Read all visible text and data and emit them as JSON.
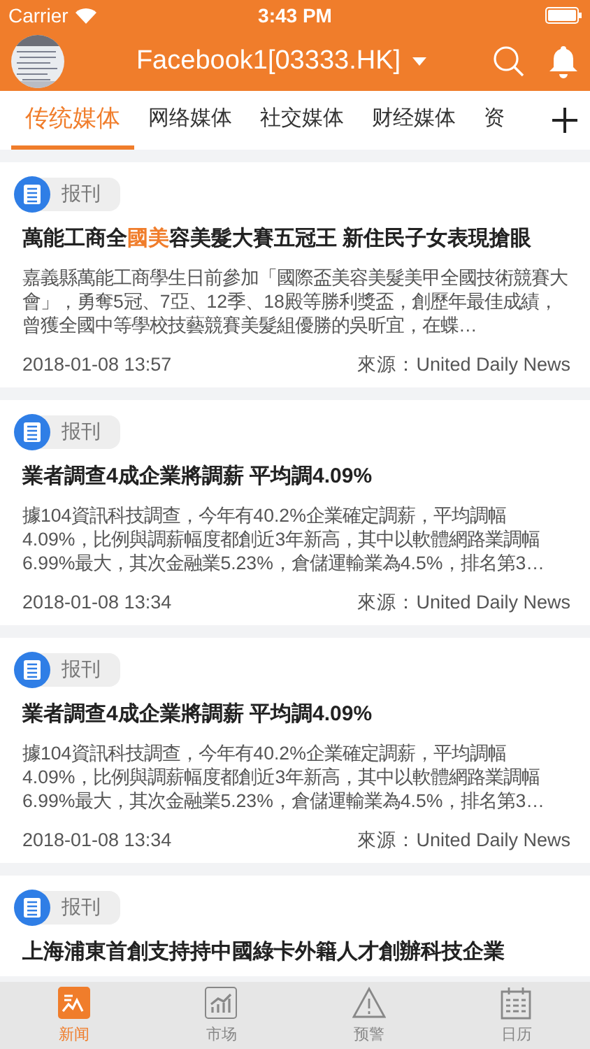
{
  "status_bar": {
    "carrier": "Carrier",
    "time": "3:43 PM"
  },
  "header": {
    "title": "Facebook1[03333.HK]"
  },
  "tabs": [
    {
      "label": "传统媒体",
      "selected": true
    },
    {
      "label": "网络媒体",
      "selected": false
    },
    {
      "label": "社交媒体",
      "selected": false
    },
    {
      "label": "财经媒体",
      "selected": false
    },
    {
      "label": "资",
      "selected": false
    }
  ],
  "articles": [
    {
      "tag": "报刊",
      "title": [
        {
          "text": "萬能工商全",
          "highlight": false
        },
        {
          "text": "國美",
          "highlight": true
        },
        {
          "text": "容美髮大賽五冠王 新住民子女表現搶眼",
          "highlight": false
        }
      ],
      "summary": "嘉義縣萬能工商學生日前參加「國際盃美容美髮美甲全國技術競賽大會」，勇奪5冠、7亞、12季、18殿等勝利獎盃，創歷年最佳成績，曾獲全國中等學校技藝競賽美髮組優勝的吳昕宜，在蝶…",
      "date": "2018-01-08 13:57",
      "source": "來源：United Daily News"
    },
    {
      "tag": "报刊",
      "title": [
        {
          "text": "業者調查4成企業將調薪 平均調4.09%",
          "highlight": false
        }
      ],
      "summary": "據104資訊科技調查，今年有40.2%企業確定調薪，平均調幅4.09%，比例與調薪幅度都創近3年新高，其中以軟體網路業調幅6.99%最大，其次金融業5.23%，倉儲運輸業為4.5%，排名第3…",
      "date": "2018-01-08 13:34",
      "source": "來源：United Daily News"
    },
    {
      "tag": "报刊",
      "title": [
        {
          "text": "業者調查4成企業將調薪  平均調4.09%",
          "highlight": false
        }
      ],
      "summary": "據104資訊科技調查，今年有40.2%企業確定調薪，平均調幅4.09%，比例與調薪幅度都創近3年新高，其中以軟體網路業調幅6.99%最大，其次金融業5.23%，倉儲運輸業為4.5%，排名第3…",
      "date": "2018-01-08 13:34",
      "source": "來源：United Daily News"
    },
    {
      "tag": "报刊",
      "title": [
        {
          "text": "上海浦東首創支持持中國綠卡外籍人才創辦科技企業",
          "highlight": false
        }
      ]
    }
  ],
  "bottom_tabs": [
    {
      "label": "新闻",
      "selected": true
    },
    {
      "label": "市场",
      "selected": false
    },
    {
      "label": "预警",
      "selected": false
    },
    {
      "label": "日历",
      "selected": false
    }
  ]
}
